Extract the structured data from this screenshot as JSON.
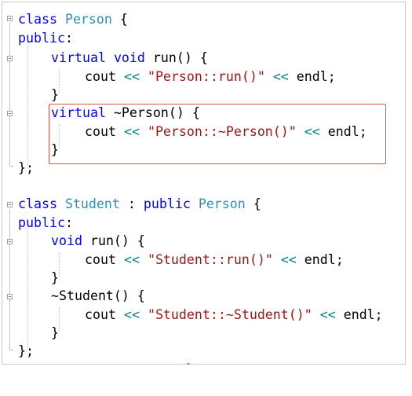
{
  "person_class": {
    "kw_class": "class",
    "name": "Person",
    "open_brace": " {",
    "access": "public",
    "colon": ":",
    "run_virtual": "virtual",
    "run_void": "void",
    "run_sig": " run() {",
    "run_cout": "cout",
    "run_op1": "<<",
    "run_str": "\"Person::run()\"",
    "run_op2": "<<",
    "run_endl": " endl;",
    "run_close": "}",
    "dtor_virtual": "virtual",
    "dtor_sig": " ~Person() {",
    "dtor_cout": "cout",
    "dtor_op1": "<<",
    "dtor_str": "\"Person::~Person()\"",
    "dtor_op2": "<<",
    "dtor_endl": " endl;",
    "dtor_close": "}",
    "close": "};"
  },
  "student_class": {
    "kw_class": "class",
    "name": "Student",
    "colon_sep": " : ",
    "kw_public": "public",
    "base": "Person",
    "open_brace": " {",
    "access": "public",
    "colon": ":",
    "run_void": "void",
    "run_sig": " run() {",
    "run_cout": "cout",
    "run_op1": "<<",
    "run_str": "\"Student::run()\"",
    "run_op2": "<<",
    "run_endl": " endl;",
    "run_close": "}",
    "dtor_sig": "~Student() {",
    "dtor_cout": "cout",
    "dtor_op1": "<<",
    "dtor_str": "\"Student::~Student()\"",
    "dtor_op2": "<<",
    "dtor_endl": " endl;",
    "dtor_close": "}",
    "close": "};"
  },
  "colors": {
    "keyword": "#0000ff",
    "type": "#2b91af",
    "string": "#a31515",
    "operator": "#008080",
    "highlight_border": "#e05050"
  }
}
